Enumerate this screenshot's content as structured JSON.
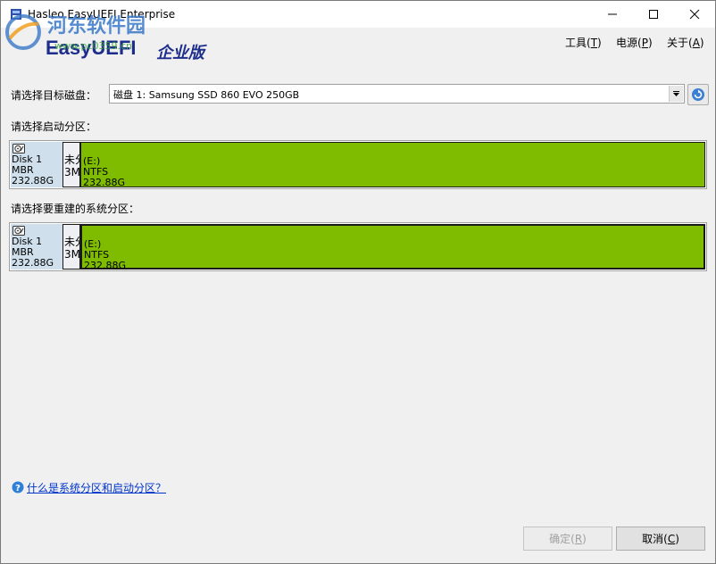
{
  "window": {
    "title": "Hasleo EasyUEFI Enterprise"
  },
  "watermark": {
    "text": "河东软件园",
    "url": "www.pc0359.cn"
  },
  "header": {
    "brand": "EasyUEFI",
    "edition": "企业版"
  },
  "menu": {
    "tools": "工具",
    "tools_key": "T",
    "power": "电源",
    "power_key": "P",
    "about": "关于",
    "about_key": "A"
  },
  "target_disk": {
    "label": "请选择目标磁盘：",
    "value": "磁盘 1: Samsung SSD 860 EVO 250GB"
  },
  "boot_partition": {
    "label": "请选择启动分区：",
    "disk": {
      "name": "Disk 1",
      "type": "MBR",
      "size": "232.88G"
    },
    "unallocated": {
      "line1": "未分",
      "line2": "3M"
    },
    "partition": {
      "drive": "(E:)",
      "fs": "NTFS",
      "size": "232.88G"
    }
  },
  "system_partition": {
    "label": "请选择要重建的系统分区：",
    "disk": {
      "name": "Disk 1",
      "type": "MBR",
      "size": "232.88G"
    },
    "unallocated": {
      "line1": "未分",
      "line2": "3M"
    },
    "partition": {
      "drive": "(E:)",
      "fs": "NTFS",
      "size": "232.88G"
    }
  },
  "help": {
    "link": "什么是系统分区和启动分区？"
  },
  "buttons": {
    "ok": "确定",
    "ok_key": "R",
    "cancel": "取消",
    "cancel_key": "C"
  },
  "colors": {
    "partition_green": "#7fbc00",
    "disk_info_bg": "#cfe0ec",
    "brand_blue": "#1d2d8c",
    "link_blue": "#0033cc"
  }
}
